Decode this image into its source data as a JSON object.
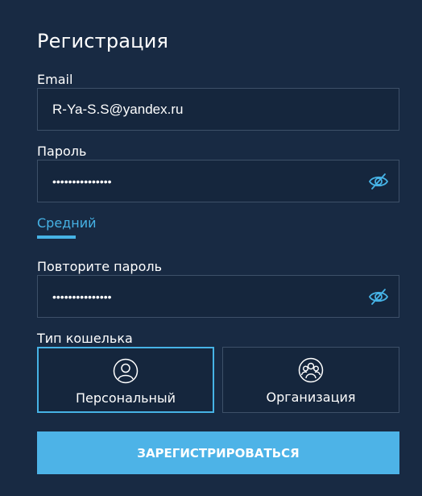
{
  "form": {
    "title": "Регистрация",
    "email": {
      "label": "Email",
      "value": "R-Ya-S.S@yandex.ru"
    },
    "password": {
      "label": "Пароль",
      "value": "•••••••••••••••",
      "toggle_icon": "eye-slash-icon"
    },
    "strength": {
      "label": "Средний",
      "color": "#46b3e6"
    },
    "repeat_password": {
      "label": "Повторите пароль",
      "value": "•••••••••••••••",
      "toggle_icon": "eye-slash-icon"
    },
    "wallet": {
      "label": "Тип кошелька",
      "options": [
        {
          "label": "Персональный",
          "icon": "person-icon",
          "selected": true
        },
        {
          "label": "Организация",
          "icon": "group-icon",
          "selected": false
        }
      ]
    },
    "submit_label": "ЗАРЕГИСТРИРОВАТЬСЯ"
  },
  "colors": {
    "background": "#182a43",
    "accent": "#46b3e6",
    "input_border": "#3d5068",
    "button": "#4db3e7"
  }
}
